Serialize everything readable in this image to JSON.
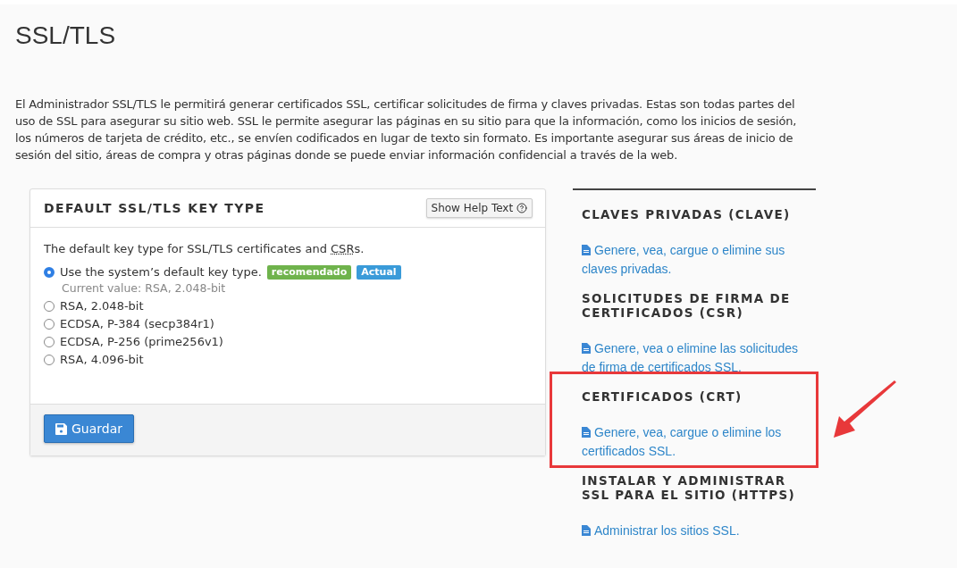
{
  "page": {
    "title": "SSL/TLS",
    "intro": "El Administrador SSL/TLS le permitirá generar certificados SSL, certificar solicitudes de firma y claves privadas. Estas son todas partes del uso de SSL para asegurar su sitio web. SSL le permite asegurar las páginas en su sitio para que la información, como los inicios de sesión, los números de tarjeta de crédito, etc., se envíen codificados en lugar de texto sin formato. Es importante asegurar sus áreas de inicio de sesión del sitio, áreas de compra y otras páginas donde se puede enviar información confidencial a través de la web."
  },
  "card": {
    "title": "DEFAULT SSL/TLS KEY TYPE",
    "help_button": "Show Help Text",
    "description": {
      "before": "The default key type for SSL/TLS certificates and ",
      "abbr": "CSR",
      "after": "s."
    },
    "options": [
      {
        "label": "Use the system’s default key type.",
        "selected": true,
        "badges": [
          {
            "text": "recomendado",
            "color": "#6fb34c"
          },
          {
            "text": "Actual",
            "color": "#3a9bd9"
          }
        ],
        "note": "Current value: RSA, 2.048-bit"
      },
      {
        "label": "RSA, 2.048-bit",
        "selected": false
      },
      {
        "label": "ECDSA, P-384 (secp384r1)",
        "selected": false
      },
      {
        "label": "ECDSA, P-256 (prime256v1)",
        "selected": false
      },
      {
        "label": "RSA, 4.096-bit",
        "selected": false
      }
    ],
    "save_button": "Guardar"
  },
  "sidebar": {
    "sections": [
      {
        "heading": "CLAVES PRIVADAS (CLAVE)",
        "link": "Genere, vea, cargue o elimine sus claves privadas."
      },
      {
        "heading": "SOLICITUDES DE FIRMA DE CERTIFICADOS (CSR)",
        "link": "Genere, vea o elimine las solicitudes de firma de certificados SSL."
      },
      {
        "heading": "CERTIFICADOS (CRT)",
        "link": "Genere, vea, cargue o elimine los certificados SSL.",
        "highlighted": true
      },
      {
        "heading": "INSTALAR Y ADMINISTRAR SSL PARA EL SITIO (HTTPS)",
        "link": "Administrar los sitios SSL."
      }
    ]
  }
}
